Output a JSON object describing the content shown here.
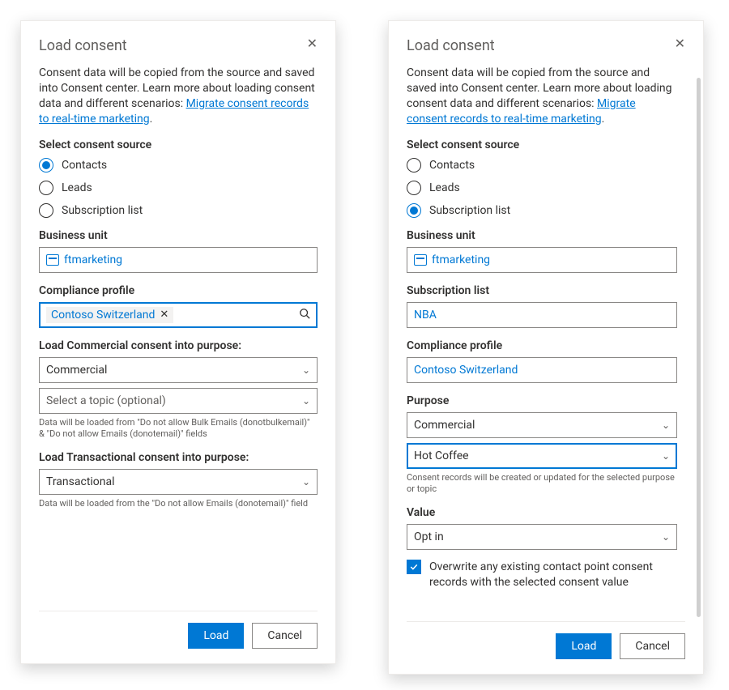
{
  "panel1": {
    "title": "Load consent",
    "intro_pre": "Consent data will be copied from the source and saved into Consent center. Learn more about loading consent data and different scenarios: ",
    "intro_link": "Migrate consent records to real-time marketing",
    "intro_post": ".",
    "select_source_label": "Select consent source",
    "radios": {
      "contacts": "Contacts",
      "leads": "Leads",
      "subscription": "Subscription list"
    },
    "selected_radio": "contacts",
    "bu_label": "Business unit",
    "bu_value": "ftmarketing",
    "compliance_label": "Compliance profile",
    "compliance_value": "Contoso Switzerland",
    "commercial_purpose_label": "Load Commercial consent into purpose:",
    "commercial_value": "Commercial",
    "commercial_topic_placeholder": "Select a topic (optional)",
    "commercial_helper": "Data will be loaded from \"Do not allow Bulk Emails (donotbulkemail)\" & \"Do not allow Emails (donotemail)\" fields",
    "transactional_purpose_label": "Load Transactional consent into purpose:",
    "transactional_value": "Transactional",
    "transactional_helper": "Data will be loaded from the \"Do not allow Emails (donotemail)\" field",
    "load": "Load",
    "cancel": "Cancel"
  },
  "panel2": {
    "title": "Load consent",
    "intro_pre": "Consent data will be copied from the source and saved into Consent center. Learn more about loading consent data and different scenarios: ",
    "intro_link": "Migrate consent records to real-time marketing",
    "intro_post": ".",
    "select_source_label": "Select consent source",
    "radios": {
      "contacts": "Contacts",
      "leads": "Leads",
      "subscription": "Subscription list"
    },
    "selected_radio": "subscription",
    "bu_label": "Business unit",
    "bu_value": "ftmarketing",
    "sublist_label": "Subscription list",
    "sublist_value": "NBA",
    "compliance_label": "Compliance profile",
    "compliance_value": "Contoso Switzerland",
    "purpose_label": "Purpose",
    "purpose_value": "Commercial",
    "purpose_topic_value": "Hot Coffee",
    "purpose_helper": "Consent records will be created or updated for the selected purpose or topic",
    "value_label": "Value",
    "value_value": "Opt in",
    "overwrite_label": "Overwrite any existing contact point consent records with the selected consent value",
    "load": "Load",
    "cancel": "Cancel"
  }
}
